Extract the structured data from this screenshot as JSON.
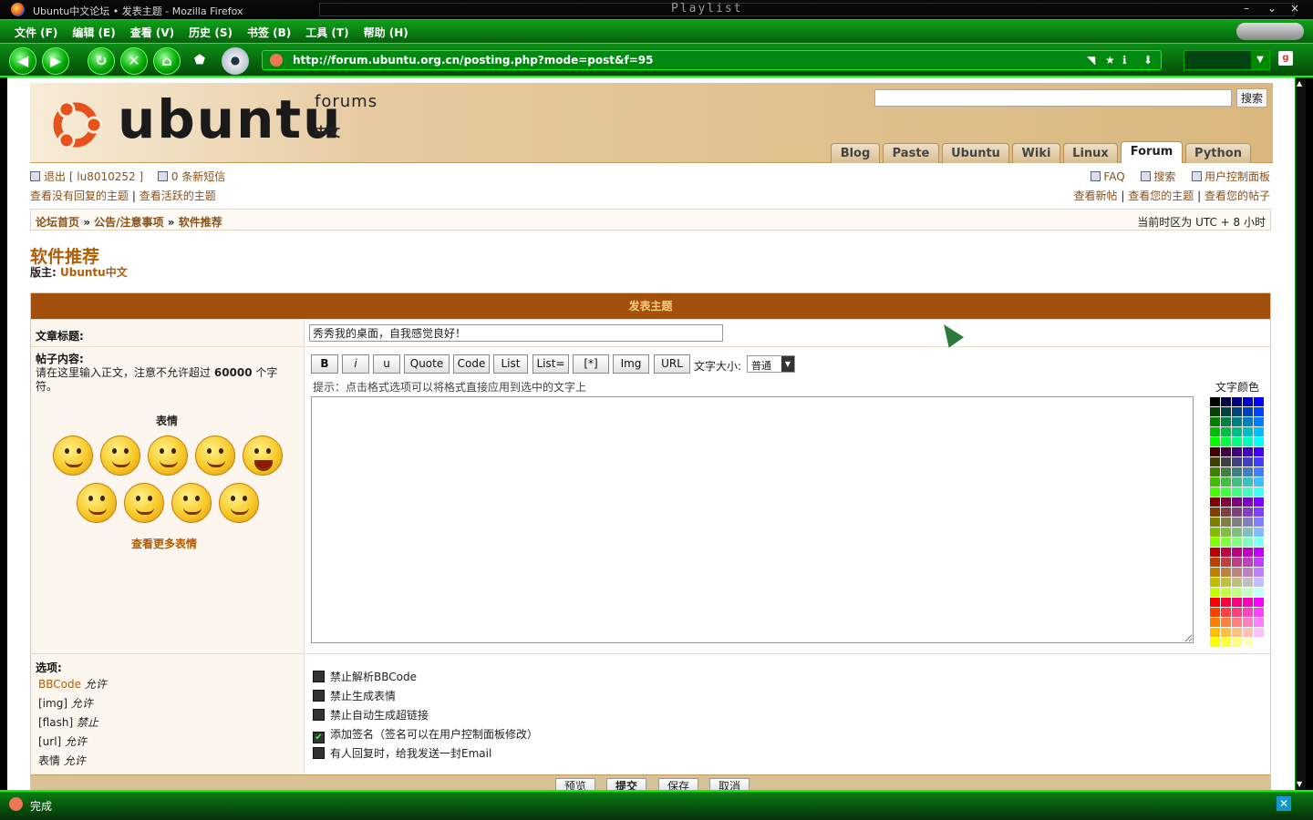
{
  "window": {
    "title": "Ubuntu中文论坛 • 发表主题 - Mozilla Firefox",
    "playlist_label": "Playlist",
    "controls": [
      "–",
      "⌄",
      "×"
    ]
  },
  "menu": [
    "文件 (F)",
    "编辑 (E)",
    "查看 (V)",
    "历史 (S)",
    "书签 (B)",
    "工具 (T)",
    "帮助 (H)"
  ],
  "toolbar": {
    "url": "http://forum.ubuntu.org.cn/posting.php?mode=post&f=95"
  },
  "header": {
    "logo_word": "ubuntu",
    "logo_forums": "forums",
    "logo_cn": "中文",
    "search_button": "搜索",
    "search_value": "",
    "tabs": [
      "Blog",
      "Paste",
      "Ubuntu",
      "Wiki",
      "Linux",
      "Forum",
      "Python"
    ],
    "active_tab": "Forum"
  },
  "user": {
    "logout": "退出 [ lu8010252 ]",
    "pm": "0 条新短信",
    "unanswered": "查看没有回复的主题",
    "sep": "|",
    "active": "查看活跃的主题"
  },
  "right_links": {
    "faq": "FAQ",
    "search": "搜索",
    "ucp": "用户控制面板",
    "new_posts": "查看新帖",
    "your_topics": "查看您的主题",
    "your_posts": "查看您的帖子"
  },
  "breadcrumb": {
    "home": "论坛首页",
    "sep": "»",
    "section": "公告/注意事项",
    "forum": "软件推荐"
  },
  "timezone": "当前时区为 UTC + 8 小时",
  "forum": {
    "title": "软件推荐",
    "moderator_label": "版主:",
    "moderator": "Ubuntu中文"
  },
  "form": {
    "header": "发表主题",
    "subject_label": "文章标题:",
    "subject_value": "秀秀我的桌面，自我感觉良好！",
    "body_label": "帖子内容:",
    "body_help": "请在这里输入正文，注意不允许超过",
    "body_limit": "60000",
    "body_help_tail": "个字符。",
    "emoticons_title": "表情",
    "emoticons_more": "查看更多表情",
    "bbcode_buttons": [
      "B",
      "i",
      "u",
      "Quote",
      "Code",
      "List",
      "List=",
      "[*]",
      "Img",
      "URL"
    ],
    "font_size_label": "文字大小:",
    "font_size_value": "普通",
    "hint": "提示：点击格式选项可以将格式直接应用到选中的文字上",
    "color_label": "文字颜色",
    "body_value": "",
    "options_label": "选项:",
    "options": [
      {
        "key": "BBCode",
        "value": "允许"
      },
      {
        "key": "[img]",
        "value": "允许"
      },
      {
        "key": "[flash]",
        "value": "禁止"
      },
      {
        "key": "[url]",
        "value": "允许"
      },
      {
        "key": "表情",
        "value": "允许"
      }
    ],
    "checkboxes": [
      {
        "label": "禁止解析BBCode",
        "checked": false
      },
      {
        "label": "禁止生成表情",
        "checked": false
      },
      {
        "label": "禁止自动生成超链接",
        "checked": false
      },
      {
        "label": "添加签名（签名可以在用户控制面板修改）",
        "checked": true
      },
      {
        "label": "有人回复时，给我发送一封Email",
        "checked": false
      }
    ],
    "buttons": [
      "预览",
      "提交",
      "保存",
      "取消"
    ]
  },
  "status": "完成"
}
